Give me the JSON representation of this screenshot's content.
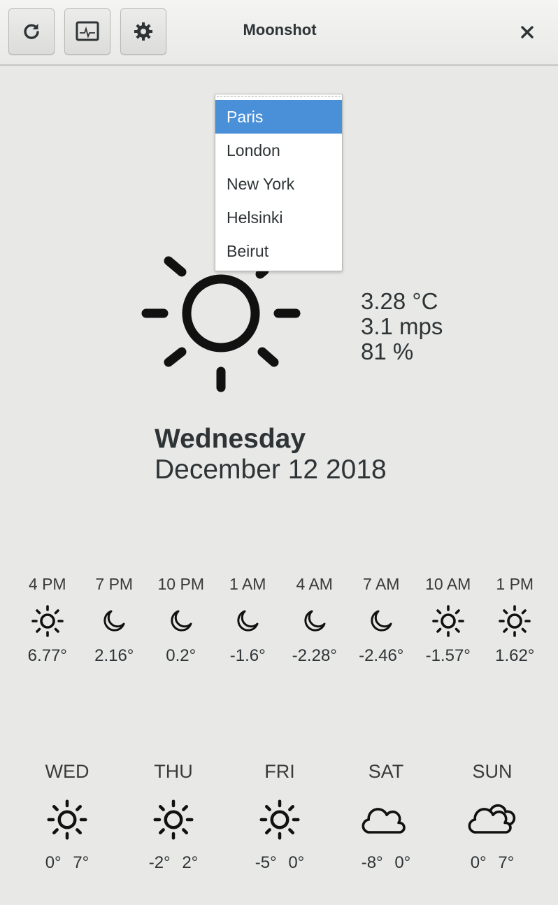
{
  "header": {
    "title": "Moonshot",
    "buttons": [
      {
        "icon": "refresh-icon"
      },
      {
        "icon": "monitor-icon"
      },
      {
        "icon": "gear-icon"
      }
    ],
    "close_icon": "close-icon"
  },
  "current": {
    "icon": "sun-icon",
    "temperature": "3.28 °C",
    "wind": "3.1 mps",
    "humidity": "81 %",
    "day": "Wednesday",
    "date": "December 12 2018"
  },
  "hourly": [
    {
      "time": "4 PM",
      "icon": "sun",
      "temp": "6.77°"
    },
    {
      "time": "7 PM",
      "icon": "moon",
      "temp": "2.16°"
    },
    {
      "time": "10 PM",
      "icon": "moon",
      "temp": "0.2°"
    },
    {
      "time": "1 AM",
      "icon": "moon",
      "temp": "-1.6°"
    },
    {
      "time": "4 AM",
      "icon": "moon",
      "temp": "-2.28°"
    },
    {
      "time": "7 AM",
      "icon": "moon",
      "temp": "-2.46°"
    },
    {
      "time": "10 AM",
      "icon": "sun",
      "temp": "-1.57°"
    },
    {
      "time": "1 PM",
      "icon": "sun",
      "temp": "1.62°"
    }
  ],
  "daily": [
    {
      "day": "WED",
      "icon": "sun",
      "low": "0°",
      "high": "7°"
    },
    {
      "day": "THU",
      "icon": "sun",
      "low": "-2°",
      "high": "2°"
    },
    {
      "day": "FRI",
      "icon": "sun",
      "low": "-5°",
      "high": "0°"
    },
    {
      "day": "SAT",
      "icon": "cloud",
      "low": "-8°",
      "high": "0°"
    },
    {
      "day": "SUN",
      "icon": "clouds",
      "low": "0°",
      "high": "7°"
    }
  ],
  "city_dropdown": {
    "selected": "Paris",
    "options": [
      "Paris",
      "London",
      "New York",
      "Helsinki",
      "Beirut"
    ],
    "highlight_color": "#4a90d9"
  }
}
